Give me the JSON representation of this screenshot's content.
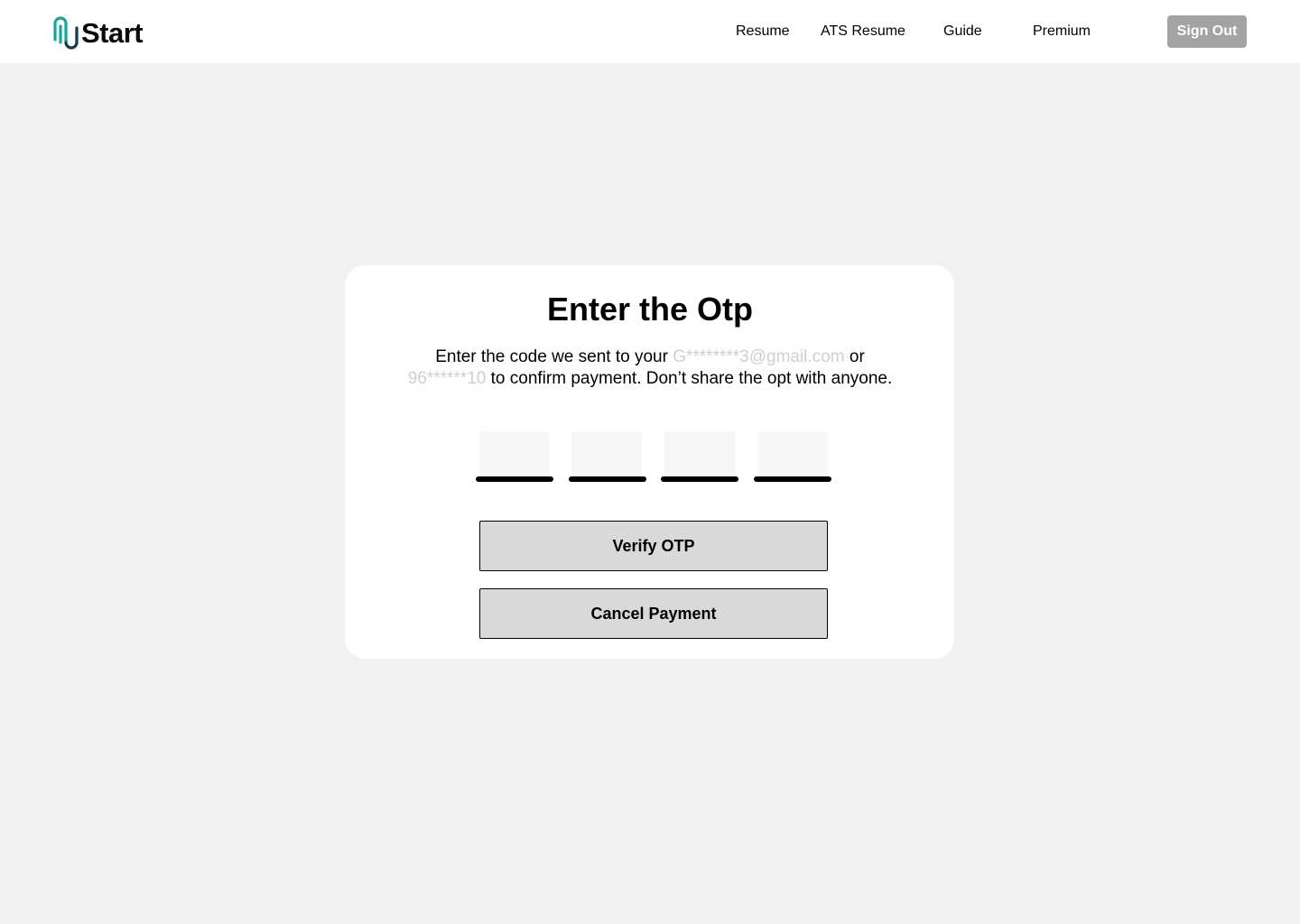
{
  "header": {
    "logo_text": "Start",
    "nav": [
      "Resume",
      "ATS Resume",
      "Guide",
      "Premium"
    ],
    "sign_out_label": "Sign Out"
  },
  "otp_dialog": {
    "title": "Enter the Otp",
    "description_prefix": "Enter the code we sent to your ",
    "masked_email": "G********3@gmail.com",
    "description_or": " or",
    "masked_phone": "96******10",
    "description_suffix": " to confirm payment. Don’t share the opt with anyone.",
    "otp_digits": [
      "",
      "",
      "",
      ""
    ],
    "verify_label": "Verify OTP",
    "cancel_label": "Cancel Payment"
  },
  "colors": {
    "page_background": "#f1f1f1",
    "logo_teal": "#14a89a",
    "logo_navy": "#0f3b57",
    "sign_out_background": "#a3a3a3",
    "masked_text": "#cfcfcf",
    "button_background": "#d9d9d9"
  }
}
